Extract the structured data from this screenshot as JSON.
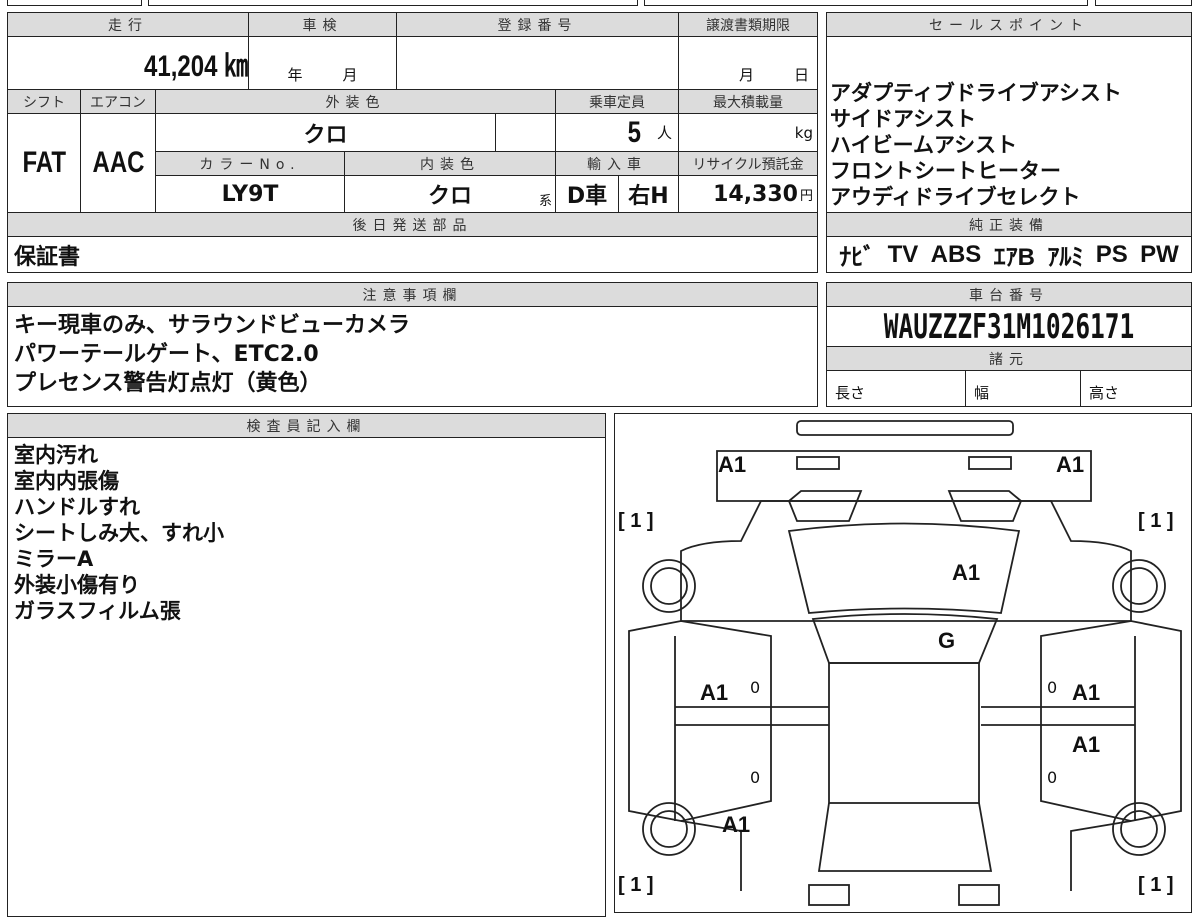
{
  "main": {
    "h_mileage": "走行",
    "mileage": "41,204 ㎞",
    "h_inspection": "車検",
    "year": "年",
    "month": "月",
    "h_reg": "登録番号",
    "h_transfer": "譲渡書類期限",
    "t_month": "月",
    "t_day": "日",
    "h_shift": "シフト",
    "shift": "FAT",
    "h_ac": "エアコン",
    "ac": "AAC",
    "h_ext": "外装色",
    "ext": "クロ",
    "h_capacity": "乗車定員",
    "capacity": "5",
    "capacity_unit": "人",
    "h_load": "最大積載量",
    "load_unit": "kg",
    "h_color_no": "カラーNo.",
    "color_no": "LY9T",
    "h_int": "内装色",
    "int": "クロ",
    "int_suffix": "系",
    "h_import": "輸入車",
    "import_dealer": "D車",
    "import_handle": "右H",
    "h_recycle": "リサイクル預託金",
    "recycle": "14,330",
    "recycle_unit": "円",
    "h_later_parts": "後日発送部品",
    "later_parts": "保証書"
  },
  "sales_points": {
    "header": "セールスポイント",
    "items": [
      "アダプティブドライブアシスト",
      "サイドアシスト",
      "ハイビームアシスト",
      "フロントシートヒーター",
      "アウディドライブセレクト"
    ]
  },
  "equipment": {
    "header": "純正装備",
    "items": [
      "ﾅﾋﾞ",
      "TV",
      "ABS",
      "ｴｱB",
      "ｱﾙﾐ",
      "PS",
      "PW"
    ]
  },
  "notes": {
    "header": "注意事項欄",
    "lines": [
      "キー現車のみ、サラウンドビューカメラ",
      "パワーテールゲート、ETC2.0",
      "プレセンス警告灯点灯（黄色）"
    ]
  },
  "chassis": {
    "header": "車台番号",
    "vin": "WAUZZZF31M1026171",
    "spec_header": "諸元",
    "length": "長さ",
    "width": "幅",
    "height": "高さ"
  },
  "inspector": {
    "header": "検査員記入欄",
    "lines": [
      "室内汚れ",
      "室内内張傷",
      "ハンドルすれ",
      "シートしみ大、すれ小",
      "ミラーA",
      "外装小傷有り",
      "ガラスフィルム張"
    ]
  },
  "diagram": {
    "front_left": "A1",
    "front_right": "A1",
    "hood": "A1",
    "windshield": "G",
    "left_front_door": "A1",
    "right_front_door": "A1",
    "right_rear_door": "A1",
    "left_rear": "A1",
    "tire": "[ 1 ]",
    "zero": "0"
  }
}
